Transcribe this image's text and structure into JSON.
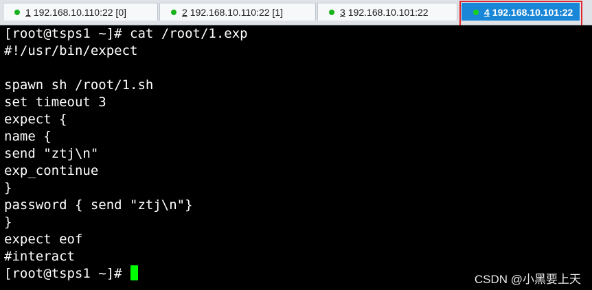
{
  "tabs": [
    {
      "num": "1",
      "title": "192.168.10.110:22 [0]"
    },
    {
      "num": "2",
      "title": "192.168.10.110:22 [1]"
    },
    {
      "num": "3",
      "title": "192.168.10.101:22"
    },
    {
      "num": "4",
      "title": "192.168.10.101:22"
    }
  ],
  "terminal": {
    "lines": [
      "[root@tsps1 ~]# cat /root/1.exp",
      "#!/usr/bin/expect",
      "",
      "spawn sh /root/1.sh",
      "set timeout 3",
      "expect {",
      "name {",
      "send \"ztj\\n\"",
      "exp_continue",
      "}",
      "password { send \"ztj\\n\"}",
      "}",
      "expect eof",
      "#interact"
    ],
    "prompt": "[root@tsps1 ~]#"
  },
  "colors": {
    "active_tab": "#1a86d8",
    "status_dot": "#19b31c",
    "cursor": "#00ff00",
    "highlight": "#e0262b"
  },
  "watermark": "CSDN @小黑要上天"
}
